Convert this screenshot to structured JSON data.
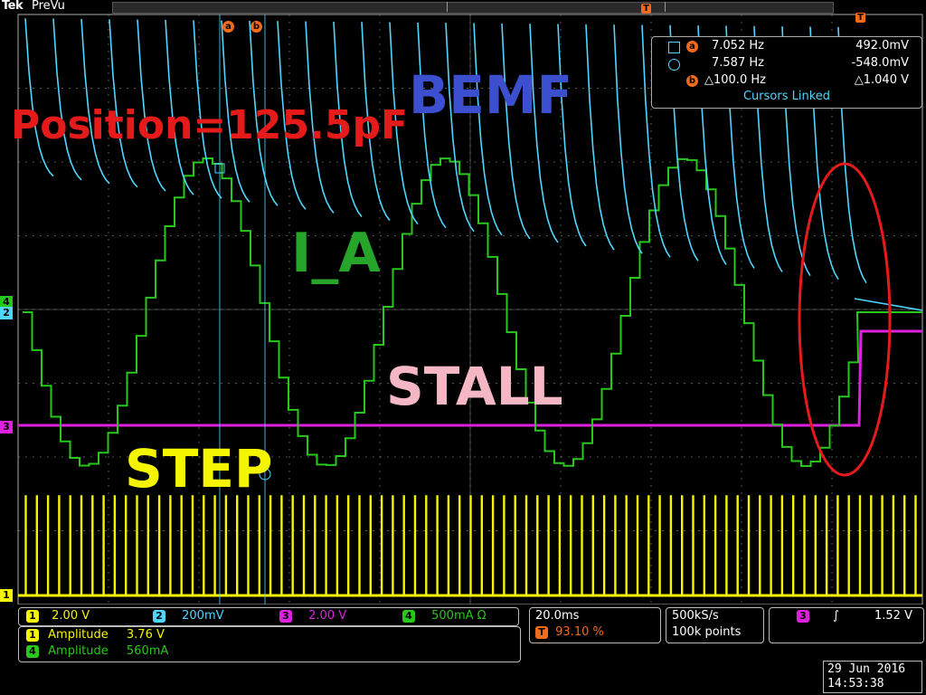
{
  "header": {
    "brand": "Tek",
    "mode": "PreVu"
  },
  "overlay_labels": {
    "position": "Position=125.5pF",
    "bemf": "BEMF",
    "current": "I_A",
    "stall": "STALL",
    "step": "STEP"
  },
  "cursor_markers": {
    "a": "a",
    "b": "b",
    "trigger": "T"
  },
  "cursor_readout": {
    "row_a": {
      "freq": "7.052 Hz",
      "volt": "492.0mV"
    },
    "row_b": {
      "freq": "7.587 Hz",
      "volt": "-548.0mV"
    },
    "row_delta": {
      "freq": "△100.0 Hz",
      "volt": "△1.040 V"
    },
    "linked": "Cursors Linked"
  },
  "channels": {
    "ch1": {
      "num": "1",
      "scale": "2.00 V",
      "color": "#f5f500"
    },
    "ch2": {
      "num": "2",
      "scale": "200mV",
      "color": "#4fd6ff"
    },
    "ch3": {
      "num": "3",
      "scale": "2.00 V",
      "color": "#e020e0"
    },
    "ch4": {
      "num": "4",
      "scale": "500mA Ω",
      "color": "#27c71c"
    }
  },
  "measurements": [
    {
      "ch": "1",
      "name": "Amplitude",
      "value": "3.76 V"
    },
    {
      "ch": "4",
      "name": "Amplitude",
      "value": "560mA"
    }
  ],
  "timebase": {
    "scale": "20.0ms",
    "trigger_pos": "93.10 %"
  },
  "acquisition": {
    "rate": "500kS/s",
    "points": "100k points"
  },
  "trigger": {
    "ch": "3",
    "slope": "∫",
    "level": "1.52 V"
  },
  "datetime": {
    "date": "29 Jun 2016",
    "time": "14:53:38"
  },
  "colors": {
    "annotation": "#e51b1b",
    "bemf_label": "#3b4fcf",
    "grid": "#8a8a8a"
  }
}
